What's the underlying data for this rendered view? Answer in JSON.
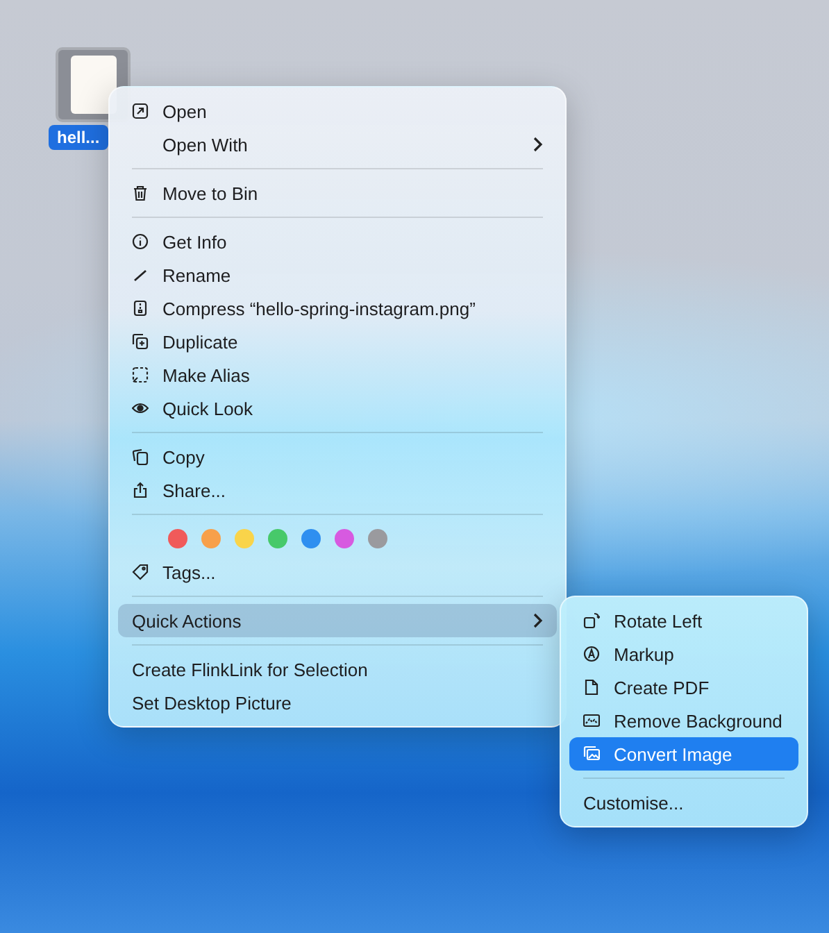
{
  "desktop_file": {
    "label": "hell...",
    "selected": true
  },
  "context_menu": {
    "sections": [
      {
        "items": [
          {
            "kind": "item",
            "label": "Open",
            "submenu": false,
            "selected": false
          },
          {
            "kind": "item",
            "label": "Open With",
            "submenu": true,
            "selected": false
          }
        ]
      },
      {
        "items": [
          {
            "kind": "item",
            "label": "Move to Bin",
            "submenu": false,
            "selected": false
          }
        ]
      },
      {
        "items": [
          {
            "kind": "item",
            "label": "Get Info",
            "submenu": false,
            "selected": false
          },
          {
            "kind": "item",
            "label": "Rename",
            "submenu": false,
            "selected": false
          },
          {
            "kind": "item",
            "label": "Compress “hello-spring-instagram.png”",
            "submenu": false,
            "selected": false
          },
          {
            "kind": "item",
            "label": "Duplicate",
            "submenu": false,
            "selected": false
          },
          {
            "kind": "item",
            "label": "Make Alias",
            "submenu": false,
            "selected": false
          },
          {
            "kind": "item",
            "label": "Quick Look",
            "submenu": false,
            "selected": false
          }
        ]
      },
      {
        "items": [
          {
            "kind": "item",
            "label": "Copy",
            "submenu": false,
            "selected": false
          },
          {
            "kind": "item",
            "label": "Share...",
            "submenu": false,
            "selected": false
          }
        ]
      },
      {
        "items": [
          {
            "kind": "colors",
            "colors": [
              {
                "color": "#f05a5a"
              },
              {
                "color": "#f7a04a"
              },
              {
                "color": "#f9d44a"
              },
              {
                "color": "#47c96a"
              },
              {
                "color": "#2f8ff0"
              },
              {
                "color": "#d75ae0"
              },
              {
                "color": "#9a9a9e"
              }
            ]
          },
          {
            "kind": "item",
            "label": "Tags...",
            "submenu": false,
            "selected": false
          }
        ]
      },
      {
        "items": [
          {
            "kind": "item",
            "label": "Quick Actions",
            "submenu": true,
            "selected": true
          }
        ]
      },
      {
        "items": [
          {
            "kind": "item",
            "label": "Create FlinkLink for Selection",
            "submenu": false,
            "selected": false
          },
          {
            "kind": "item",
            "label": "Set Desktop Picture",
            "submenu": false,
            "selected": false
          }
        ]
      }
    ]
  },
  "quick_actions_menu": {
    "sections": [
      {
        "items": [
          {
            "label": "Rotate Left",
            "selected": false
          },
          {
            "label": "Markup",
            "selected": false
          },
          {
            "label": "Create PDF",
            "selected": false
          },
          {
            "label": "Remove Background",
            "selected": false
          },
          {
            "label": "Convert Image",
            "selected": true
          }
        ]
      },
      {
        "items": [
          {
            "label": "Customise...",
            "selected": false
          }
        ]
      }
    ]
  }
}
